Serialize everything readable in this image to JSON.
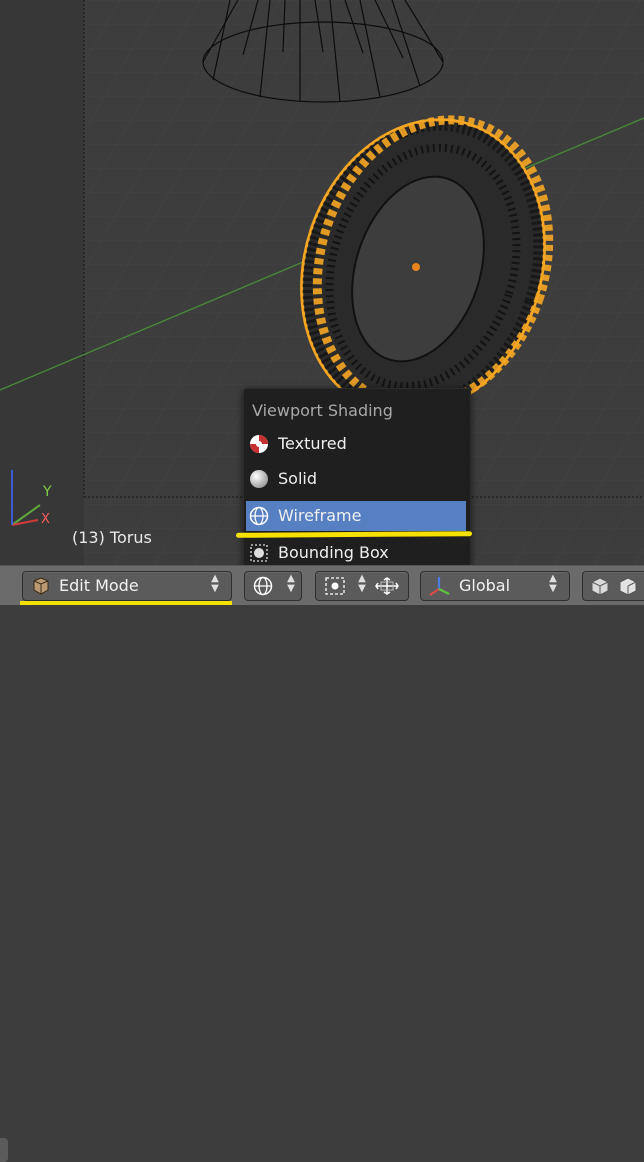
{
  "viewport": {
    "object_label": "(13) Torus",
    "axis_labels": {
      "x": "X",
      "y": "Y"
    }
  },
  "shading_menu": {
    "title": "Viewport Shading",
    "items": [
      {
        "label": "Textured",
        "icon": "textured-icon",
        "active": false
      },
      {
        "label": "Solid",
        "icon": "solid-icon",
        "active": false
      },
      {
        "label": "Wireframe",
        "icon": "wireframe-icon",
        "active": true
      },
      {
        "label": "Bounding Box",
        "icon": "bounding-box-icon",
        "active": false
      }
    ]
  },
  "header": {
    "mode": "Edit Mode",
    "orientation": "Global"
  },
  "colors": {
    "viewport_bg": "#3d3d3d",
    "selection": "#f5a623",
    "menu_active": "#5680c2",
    "annotation": "#f5e000"
  }
}
